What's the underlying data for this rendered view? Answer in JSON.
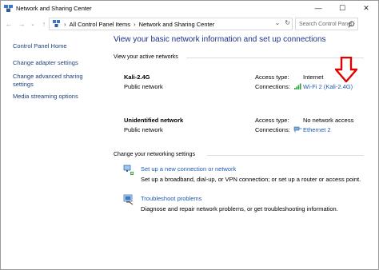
{
  "window": {
    "title": "Network and Sharing Center",
    "controls": {
      "minimize": "—",
      "maximize": "☐",
      "close": "✕"
    }
  },
  "address_bar": {
    "back": "←",
    "forward": "→",
    "up": "↑",
    "separator": "›",
    "breadcrumbs": [
      "All Control Panel Items",
      "Network and Sharing Center"
    ],
    "dropdown": "⌄",
    "refresh": "↻",
    "search_placeholder": "Search Control Panel"
  },
  "left_pane": {
    "links": [
      "Control Panel Home",
      "Change adapter settings",
      "Change advanced sharing settings",
      "Media streaming options"
    ]
  },
  "main": {
    "title": "View your basic network information and set up connections",
    "active_networks_header": "View your active networks",
    "networks": [
      {
        "name": "Kali-2.4G",
        "type": "Public network",
        "access_type_label": "Access type:",
        "access_type": "Internet",
        "connections_label": "Connections:",
        "connection": "Wi-Fi 2 (Kali-2.4G)"
      },
      {
        "name": "Unidentified network",
        "type": "Public network",
        "access_type_label": "Access type:",
        "access_type": "No network access",
        "connections_label": "Connections:",
        "connection": "Ethernet 2"
      }
    ],
    "settings_header": "Change your networking settings",
    "tasks": [
      {
        "link": "Set up a new connection or network",
        "desc": "Set up a broadband, dial-up, or VPN connection; or set up a router or access point.",
        "icon": "new-connection-icon"
      },
      {
        "link": "Troubleshoot problems",
        "desc": "Diagnose and repair network problems, or get troubleshooting information.",
        "icon": "troubleshoot-icon"
      }
    ]
  },
  "colors": {
    "link": "#1e5ab4",
    "title_blue": "#1e3287",
    "annotation_red": "#e00000"
  }
}
